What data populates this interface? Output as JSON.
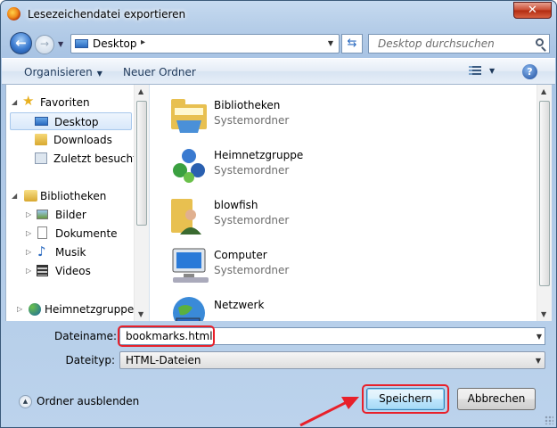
{
  "window": {
    "title": "Lesezeichendatei exportieren",
    "close_label": "✕"
  },
  "nav": {
    "back_icon": "back-arrow-icon",
    "forward_icon": "forward-arrow-icon",
    "address": {
      "location": "Desktop",
      "separator": "▸"
    },
    "search_placeholder": "Desktop durchsuchen"
  },
  "toolbar": {
    "organize_label": "Organisieren",
    "new_folder_label": "Neuer Ordner",
    "help_label": "?"
  },
  "sidebar": {
    "favorites": {
      "label": "Favoriten",
      "items": [
        {
          "label": "Desktop",
          "icon": "desktop-icon",
          "selected": true
        },
        {
          "label": "Downloads",
          "icon": "downloads-folder-icon"
        },
        {
          "label": "Zuletzt besucht",
          "icon": "recent-places-icon"
        }
      ]
    },
    "libraries": {
      "label": "Bibliotheken",
      "items": [
        {
          "label": "Bilder",
          "icon": "pictures-icon"
        },
        {
          "label": "Dokumente",
          "icon": "documents-icon"
        },
        {
          "label": "Musik",
          "icon": "music-icon"
        },
        {
          "label": "Videos",
          "icon": "videos-icon"
        }
      ]
    },
    "homegroup": {
      "label": "Heimnetzgruppe"
    }
  },
  "files": [
    {
      "name": "Bibliotheken",
      "type": "Systemordner",
      "icon": "libraries-icon"
    },
    {
      "name": "Heimnetzgruppe",
      "type": "Systemordner",
      "icon": "homegroup-icon"
    },
    {
      "name": "blowfish",
      "type": "Systemordner",
      "icon": "user-folder-icon"
    },
    {
      "name": "Computer",
      "type": "Systemordner",
      "icon": "computer-icon"
    },
    {
      "name": "Netzwerk",
      "type": "",
      "icon": "network-icon"
    }
  ],
  "form": {
    "filename_label": "Dateiname:",
    "filename_value": "bookmarks.html",
    "filetype_label": "Dateityp:",
    "filetype_value": "HTML-Dateien"
  },
  "footer": {
    "hide_folders_label": "Ordner ausblenden",
    "save_label": "Speichern",
    "cancel_label": "Abbrechen"
  },
  "colors": {
    "highlight": "#e8202a",
    "accent": "#1e395b"
  }
}
